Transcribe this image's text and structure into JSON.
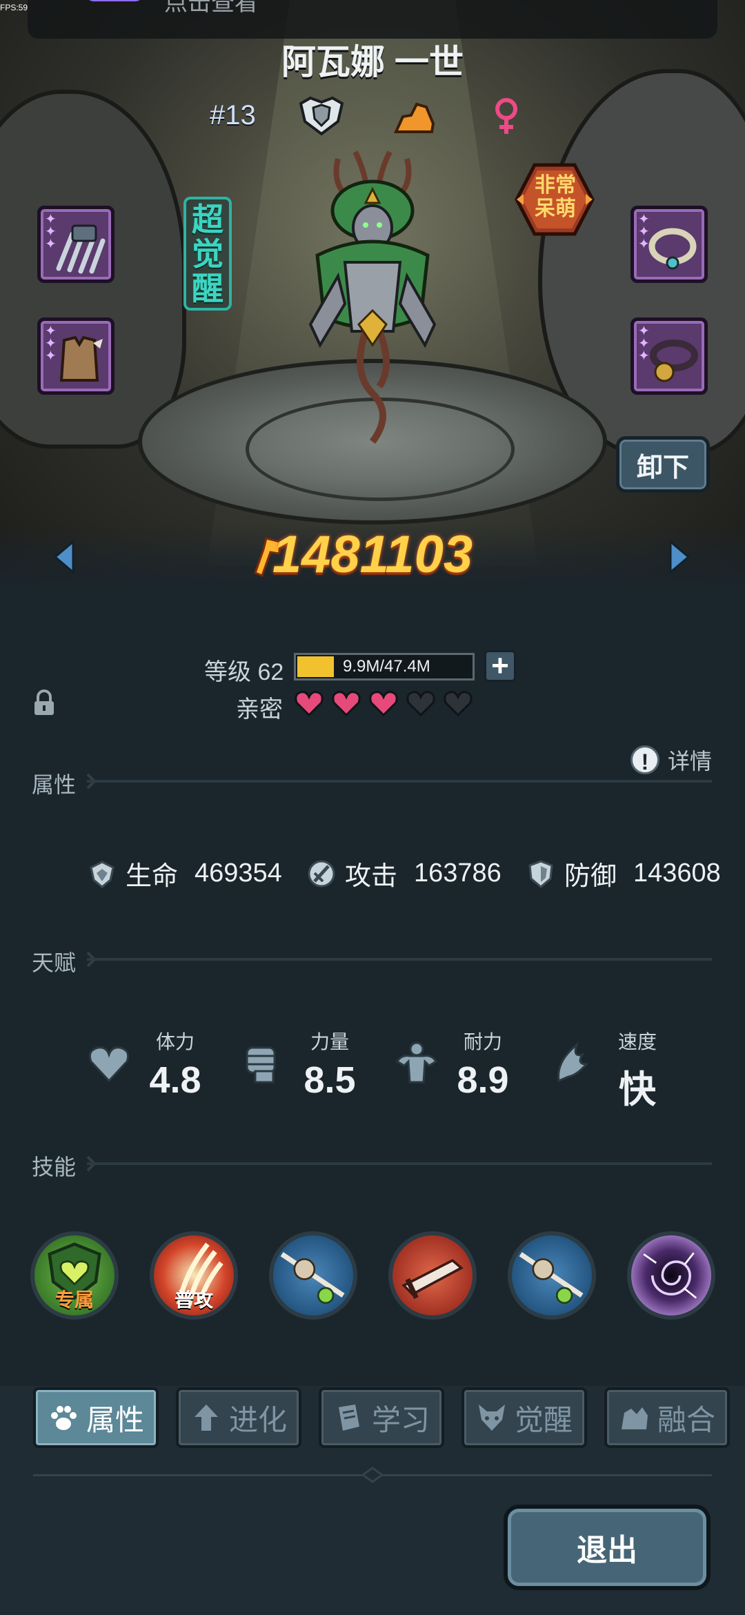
{
  "status": {
    "fps_text": "FPS:59",
    "notification_text": "点击查看"
  },
  "hero": {
    "name": "阿瓦娜 一世",
    "rank": "#13",
    "awaken_badge": [
      "超",
      "觉",
      "醒"
    ],
    "cute_badge": [
      "非常",
      "呆萌"
    ],
    "power": "1481103",
    "unequip_label": "卸下"
  },
  "level": {
    "label": "等级 62",
    "xp_text": "9.9M/47.4M",
    "xp_current": 9.9,
    "xp_max": 47.4
  },
  "intimacy": {
    "label": "亲密",
    "filled": 3,
    "total": 5,
    "filled_color": "#e64a7a",
    "empty_color": "#2d3339"
  },
  "detail_label": "详情",
  "sections": {
    "attributes": "属性",
    "talents": "天赋",
    "skills": "技能"
  },
  "stats": [
    {
      "name": "生命",
      "value": "469354",
      "icon": "heart-shield-icon"
    },
    {
      "name": "攻击",
      "value": "163786",
      "icon": "sword-icon"
    },
    {
      "name": "防御",
      "value": "143608",
      "icon": "shield-icon"
    }
  ],
  "talents": [
    {
      "name": "体力",
      "value": "4.8",
      "icon": "heart-icon"
    },
    {
      "name": "力量",
      "value": "8.5",
      "icon": "fist-icon"
    },
    {
      "name": "耐力",
      "value": "8.9",
      "icon": "muscle-icon"
    },
    {
      "name": "速度",
      "value": "快",
      "icon": "wing-icon"
    }
  ],
  "skills": [
    {
      "label": "专属",
      "icon": "heart-shield-skill-icon"
    },
    {
      "label": "普攻",
      "icon": "claw-slash-skill-icon"
    },
    {
      "label": "",
      "icon": "spear-skill-icon"
    },
    {
      "label": "",
      "icon": "sword-skill-icon"
    },
    {
      "label": "",
      "icon": "spear-skill-icon"
    },
    {
      "label": "",
      "icon": "vortex-skill-icon"
    }
  ],
  "tabs": [
    {
      "label": "属性",
      "icon": "paw-icon",
      "active": true
    },
    {
      "label": "进化",
      "icon": "arrow-up-icon",
      "active": false
    },
    {
      "label": "学习",
      "icon": "book-icon",
      "active": false
    },
    {
      "label": "觉醒",
      "icon": "demon-icon",
      "active": false
    },
    {
      "label": "融合",
      "icon": "fusion-icon",
      "active": false
    }
  ],
  "exit_label": "退出",
  "colors": {
    "accent_gold": "#ffd24a",
    "awaken_teal": "#3bd6c2",
    "active_tab": "#5c8898",
    "epic_purple": "#5b3a6e"
  }
}
